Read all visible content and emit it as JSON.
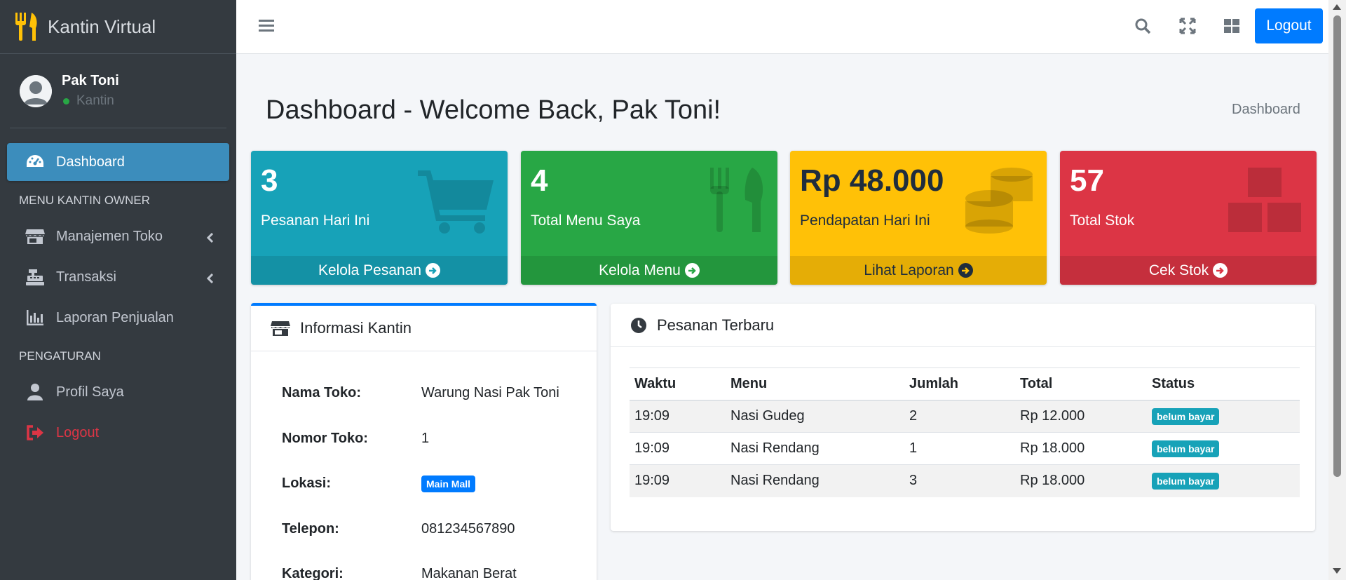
{
  "brand": {
    "name": "Kantin Virtual",
    "accent": "#ffc107"
  },
  "user": {
    "name": "Pak Toni",
    "role": "Kantin",
    "status_color": "#28a745"
  },
  "sidebar": {
    "items": [
      {
        "label": "Dashboard",
        "icon": "tachometer-icon",
        "active": true
      },
      {
        "header": "MENU KANTIN OWNER"
      },
      {
        "label": "Manajemen Toko",
        "icon": "store-icon"
      },
      {
        "label": "Transaksi",
        "icon": "cash-register-icon"
      },
      {
        "label": "Laporan Penjualan",
        "icon": "chart-bar-icon"
      },
      {
        "header": "PENGATURAN"
      },
      {
        "label": "Profil Saya",
        "icon": "user-icon"
      },
      {
        "label": "Logout",
        "icon": "sign-out-icon"
      }
    ]
  },
  "topbar": {
    "logout_label": "Logout"
  },
  "page": {
    "title": "Dashboard - Welcome Back, Pak Toni!",
    "breadcrumb": "Dashboard"
  },
  "stats": [
    {
      "value": "3",
      "label": "Pesanan Hari Ini",
      "link": "Kelola Pesanan",
      "color": "#17a2b8",
      "icon": "shopping-cart-icon"
    },
    {
      "value": "4",
      "label": "Total Menu Saya",
      "link": "Kelola Menu",
      "color": "#28a745",
      "icon": "utensils-icon"
    },
    {
      "value": "Rp 48.000",
      "label": "Pendapatan Hari Ini",
      "link": "Lihat Laporan",
      "color": "#ffc107",
      "icon": "coins-icon"
    },
    {
      "value": "57",
      "label": "Total Stok",
      "link": "Cek Stok",
      "color": "#dc3545",
      "icon": "boxes-icon"
    }
  ],
  "info": {
    "title": "Informasi Kantin",
    "rows": [
      {
        "label": "Nama Toko:",
        "value": "Warung Nasi Pak Toni"
      },
      {
        "label": "Nomor Toko:",
        "value": "1"
      },
      {
        "label": "Lokasi:",
        "value": "Main Mall"
      },
      {
        "label": "Telepon:",
        "value": "081234567890"
      },
      {
        "label": "Kategori:",
        "value": "Makanan Berat"
      }
    ]
  },
  "orders": {
    "title": "Pesanan Terbaru",
    "columns": [
      "Waktu",
      "Menu",
      "Jumlah",
      "Total",
      "Status"
    ],
    "rows": [
      {
        "time": "19:09",
        "menu": "Nasi Gudeg",
        "qty": "2",
        "total": "Rp 12.000",
        "status": "belum bayar"
      },
      {
        "time": "19:09",
        "menu": "Nasi Rendang",
        "qty": "1",
        "total": "Rp 18.000",
        "status": "belum bayar"
      },
      {
        "time": "19:09",
        "menu": "Nasi Rendang",
        "qty": "3",
        "total": "Rp 18.000",
        "status": "belum bayar"
      }
    ]
  }
}
